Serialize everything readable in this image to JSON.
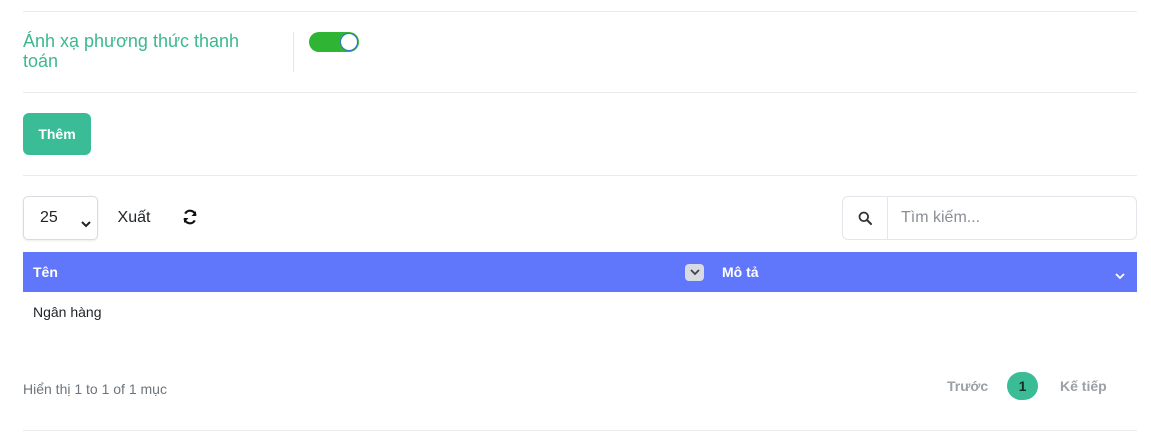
{
  "setting": {
    "label": "Ánh xạ phương thức thanh toán",
    "toggle_on": true
  },
  "actions": {
    "add_label": "Thêm"
  },
  "toolbar": {
    "page_size": "25",
    "export_label": "Xuất",
    "refresh_icon": "refresh-icon",
    "search_icon": "search-icon",
    "search_placeholder": "Tìm kiếm..."
  },
  "table": {
    "columns": [
      "Tên",
      "Mô tả"
    ],
    "rows": [
      [
        "Ngân hàng",
        ""
      ]
    ]
  },
  "footer": {
    "info": "Hiển thị 1 to 1 of 1 mục",
    "prev_label": "Trước",
    "current_page": "1",
    "next_label": "Kế tiếp"
  },
  "colors": {
    "accent": "#3abd97",
    "table_header": "#6177fb",
    "toggle_on": "#2fb533",
    "label_green": "#3cb891"
  }
}
